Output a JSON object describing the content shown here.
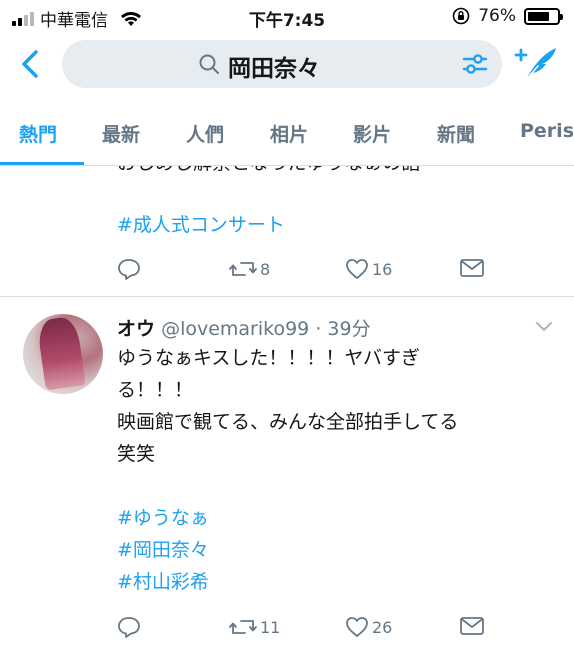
{
  "status_bar": {
    "carrier": "中華電信",
    "time": "下午7:45",
    "battery": "76%",
    "battery_level": 0.76,
    "icons": [
      "signal-icon",
      "wifi-icon",
      "rotation-lock-icon",
      "battery-icon"
    ]
  },
  "header": {
    "search_query": "岡田奈々",
    "icons": [
      "back-chevron-icon",
      "search-icon",
      "filter-sliders-icon",
      "compose-tweet-icon"
    ]
  },
  "tabs": [
    "熱門",
    "最新",
    "人們",
    "相片",
    "影片",
    "新聞",
    "Peris"
  ],
  "active_tab": 0,
  "colors": {
    "accent": "#1da1f2",
    "secondary_text": "#657786",
    "search_bg": "#e6ecf0"
  },
  "tweets": [
    {
      "partial_line": "おしめし解禁となったゆうなぁの話",
      "hashtags": [
        "#成人式コンサート"
      ],
      "retweets": "8",
      "likes": "16"
    },
    {
      "name": "オウ",
      "handle": "@lovemariko99",
      "time": "· 39分",
      "lines": [
        "ゆうなぁキスした！！！！ヤバすぎ",
        "る！！！",
        "映画館で観てる、みんな全部拍手してる",
        "笑笑"
      ],
      "hashtags": [
        "#ゆうなぁ",
        "#岡田奈々",
        "#村山彩希"
      ],
      "retweets": "11",
      "likes": "26"
    }
  ]
}
